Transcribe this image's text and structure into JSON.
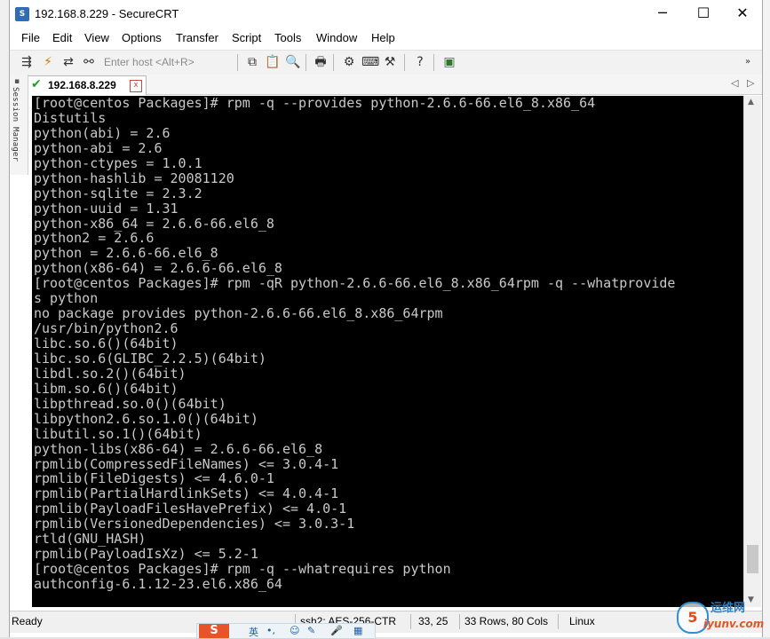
{
  "window": {
    "title": "192.168.8.229 - SecureCRT",
    "app_icon": "securecrt-icon",
    "controls": [
      "─",
      "☐",
      "✕"
    ]
  },
  "menu": [
    "File",
    "Edit",
    "View",
    "Options",
    "Transfer",
    "Script",
    "Tools",
    "Window",
    "Help"
  ],
  "toolbar": {
    "host_placeholder": "Enter host <Alt+R>"
  },
  "tab": {
    "label": "192.168.8.229",
    "close": "x",
    "nav_prev": "◁",
    "nav_next": "▷"
  },
  "session_manager": {
    "label": "Session Manager"
  },
  "terminal": {
    "lines": [
      "[root@centos Packages]# rpm -q --provides python-2.6.6-66.el6_8.x86_64",
      "Distutils",
      "python(abi) = 2.6",
      "python-abi = 2.6",
      "python-ctypes = 1.0.1",
      "python-hashlib = 20081120",
      "python-sqlite = 2.3.2",
      "python-uuid = 1.31",
      "python-x86_64 = 2.6.6-66.el6_8",
      "python2 = 2.6.6",
      "python = 2.6.6-66.el6_8",
      "python(x86-64) = 2.6.6-66.el6_8",
      "[root@centos Packages]# rpm -qR python-2.6.6-66.el6_8.x86_64rpm -q --whatprovide",
      "s python",
      "no package provides python-2.6.6-66.el6_8.x86_64rpm",
      "/usr/bin/python2.6",
      "libc.so.6()(64bit)",
      "libc.so.6(GLIBC_2.2.5)(64bit)",
      "libdl.so.2()(64bit)",
      "libm.so.6()(64bit)",
      "libpthread.so.0()(64bit)",
      "libpython2.6.so.1.0()(64bit)",
      "libutil.so.1()(64bit)",
      "python-libs(x86-64) = 2.6.6-66.el6_8",
      "rpmlib(CompressedFileNames) <= 3.0.4-1",
      "rpmlib(FileDigests) <= 4.6.0-1",
      "rpmlib(PartialHardlinkSets) <= 4.0.4-1",
      "rpmlib(PayloadFilesHavePrefix) <= 4.0-1",
      "rpmlib(VersionedDependencies) <= 3.0.3-1",
      "rtld(GNU_HASH)",
      "rpmlib(PayloadIsXz) <= 5.2-1",
      "[root@centos Packages]# rpm -q --whatrequires python",
      "authconfig-6.1.12-23.el6.x86_64"
    ]
  },
  "status": {
    "ready": "Ready",
    "cipher": "ssh2: AES-256-CTR",
    "position": "33,  25",
    "size": "33 Rows, 80 Cols",
    "os": "Linux"
  },
  "ime": {
    "logo": "S",
    "lang": "英"
  },
  "watermark": {
    "cn": "运维网",
    "en": "iyunv.com"
  },
  "colors": {
    "terminal_bg": "#000000",
    "terminal_fg": "#c9c9c9",
    "tab_check": "#1aa520",
    "tab_close": "#c24a4a"
  }
}
